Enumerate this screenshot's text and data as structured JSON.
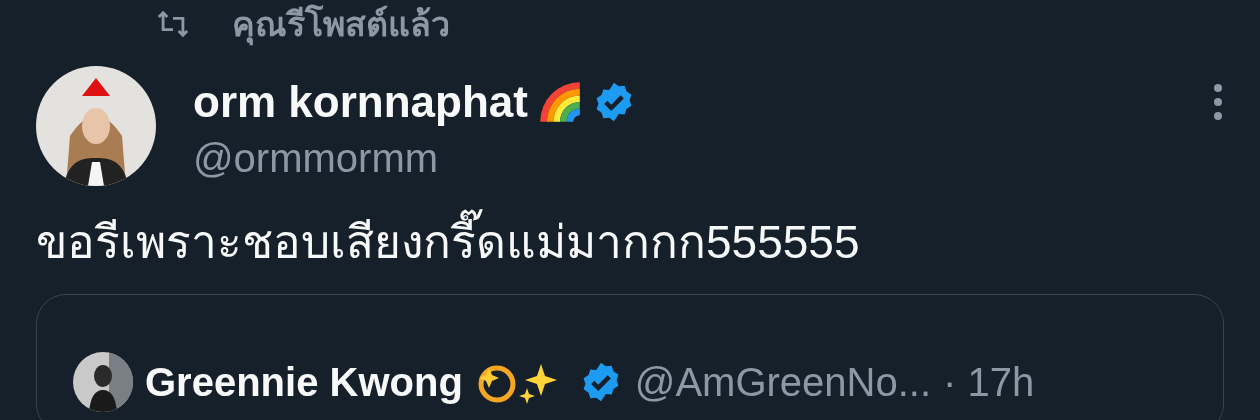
{
  "repost_header": {
    "label": "คุณรีโพสต์แล้ว"
  },
  "post": {
    "author": {
      "name": "orm kornnaphat",
      "verified": true,
      "handle": "@ormmormm"
    },
    "text": "ขอรีเพราะชอบเสียงกรี๊ดแม่มากกก555555",
    "quote": {
      "author": {
        "name": "Greennie Kwong",
        "verified": true,
        "handle": "@AmGreenNo..."
      },
      "time": "· 17h"
    }
  }
}
